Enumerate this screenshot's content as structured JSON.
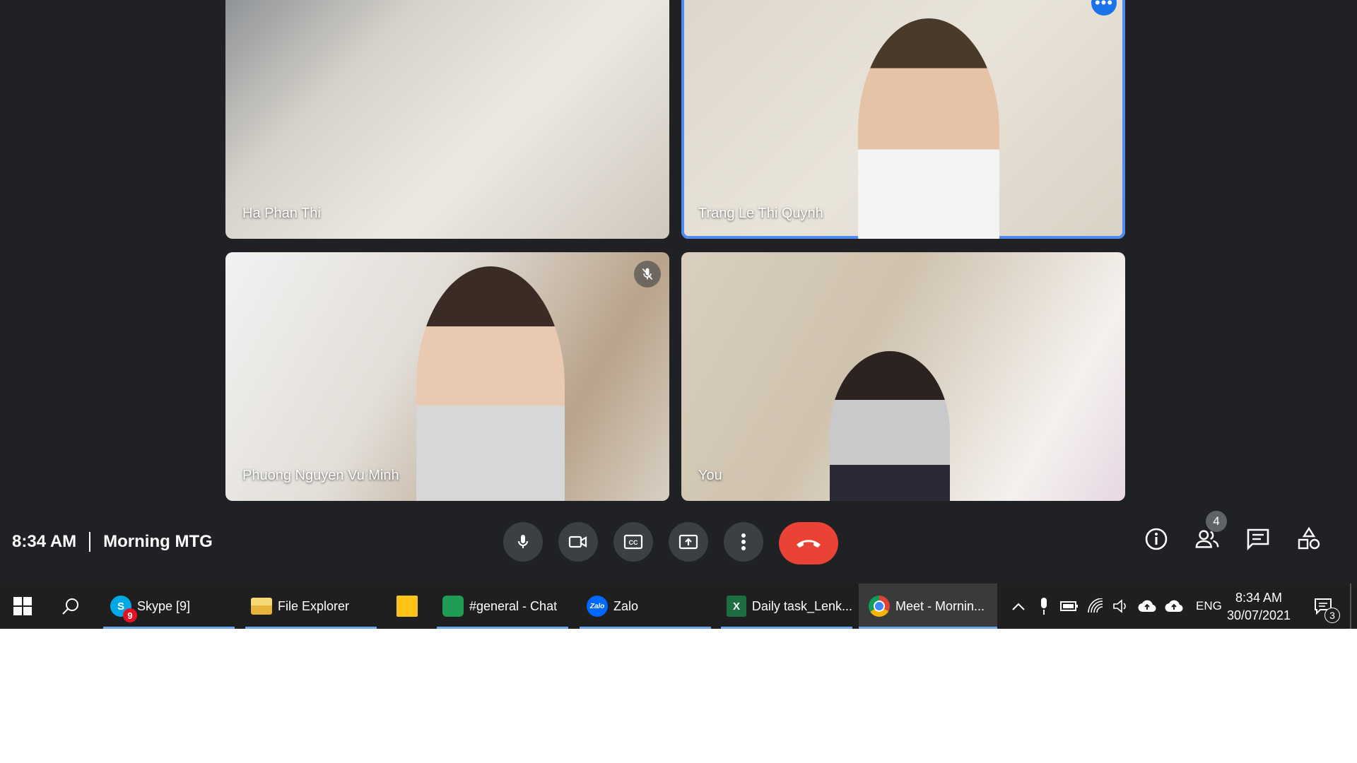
{
  "participants": [
    {
      "name": "Ha Phan Thi"
    },
    {
      "name": "Trang Le Thi Quynh"
    },
    {
      "name": "Phuong Nguyen Vu Minh"
    },
    {
      "name": "You"
    }
  ],
  "meeting": {
    "time": "8:34 AM",
    "title": "Morning MTG",
    "people_count": "4"
  },
  "controls": {
    "mic": "microphone-icon",
    "camera": "camera-icon",
    "captions": "captions-icon",
    "present": "present-screen-icon",
    "more": "more-vertical-icon",
    "end": "end-call-icon"
  },
  "colors": {
    "end_call": "#ea4335",
    "active_speaker": "#4d8bf5",
    "taskbar": "#1f1f1f"
  },
  "taskbar": {
    "items": [
      {
        "label": "Skype [9]",
        "badge": "9"
      },
      {
        "label": "File Explorer"
      },
      {
        "label": ""
      },
      {
        "label": "#general - Chat"
      },
      {
        "label": "Zalo",
        "icon_text": "Zalo"
      },
      {
        "label": "Daily task_Lenk...",
        "icon_text": "X"
      },
      {
        "label": "Meet - Mornin..."
      }
    ],
    "tray": {
      "language": "ENG",
      "time": "8:34 AM",
      "date": "30/07/2021",
      "notifications": "3"
    }
  }
}
